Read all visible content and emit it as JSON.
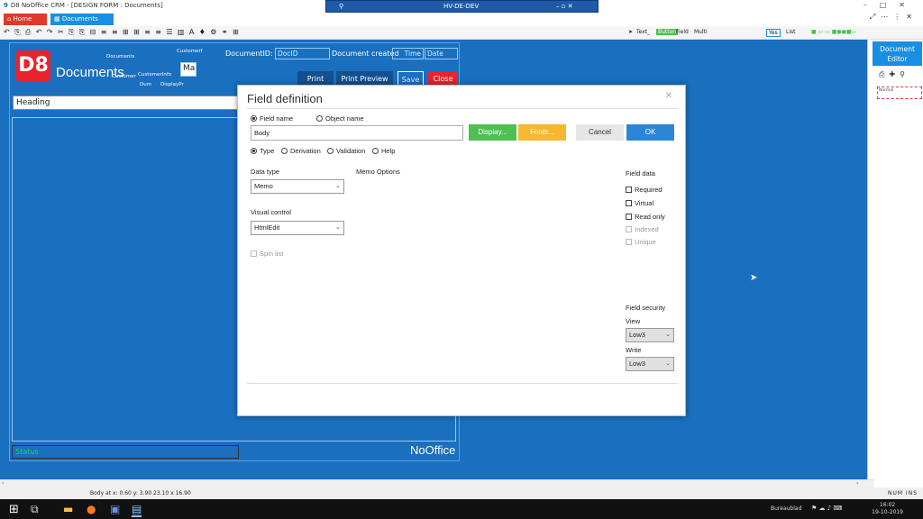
{
  "window": {
    "title": "D8 NoOffice CRM - [DESIGN FORM : Documents]",
    "rdp_host": "HV-DE-DEV"
  },
  "tabs": [
    {
      "label": "Home"
    },
    {
      "label": "Documents"
    }
  ],
  "toolbar_right": {
    "text_label": "Text_",
    "button_badge": "Button",
    "field_label": "Field",
    "multi_label": "Multi",
    "yes_label": "Yes",
    "list_label": "List"
  },
  "form": {
    "logo_text": "D8",
    "title": "Documents",
    "small_labels": [
      "Documents",
      "Customer",
      "CustomerInfo",
      "Customerf",
      "Dum",
      "DisplayPr"
    ],
    "ma_box": "Ma",
    "document_id_label": "DocumentID:",
    "document_id_value": "DocID",
    "document_created_label": "Document created",
    "time_value": "Time",
    "date_value": "Date",
    "buttons": {
      "print": "Print",
      "print_preview": "Print Preview",
      "save": "Save",
      "close": "Close"
    },
    "heading_field": "Heading",
    "status_field": "Status",
    "brand": "NoOffice"
  },
  "right_panel": {
    "title": "Document Editor",
    "sample_text": "Normal"
  },
  "statusbar": {
    "coords": "Body   at  x: 0.60  y: 3.90      23.10 x 16.90",
    "num": "NUM   INS"
  },
  "taskbar": {
    "desktop_label": "Bureaublad",
    "time": "16:02",
    "date": "19-10-2019"
  },
  "dialog": {
    "title": "Field definition",
    "radio_fieldname": "Field name",
    "radio_objectname": "Object name",
    "name_value": "Body",
    "btn_display": "Display...",
    "btn_fonts": "Fonts...",
    "btn_cancel": "Cancel",
    "btn_ok": "OK",
    "tab_type": "Type",
    "tab_derivation": "Derivation",
    "tab_validation": "Validation",
    "tab_help": "Help",
    "data_type_label": "Data type",
    "data_type_value": "Memo",
    "memo_options_label": "Memo Options",
    "visual_control_label": "Visual control",
    "visual_control_value": "HtmlEdit",
    "spin_list_label": "Spin list",
    "field_data_label": "Field data",
    "required_label": "Required",
    "virtual_label": "Virtual",
    "readonly_label": "Read only",
    "indexed_label": "Indexed",
    "unique_label": "Unique",
    "field_security_label": "Field security",
    "view_label": "View",
    "view_value": "Low3",
    "write_label": "Write",
    "write_value": "Low3"
  },
  "colors": {
    "canvas": "#1a6fbf",
    "home_tab": "#e03a2a",
    "documents_tab": "#1a8ee0",
    "display_btn": "#4cc050",
    "fonts_btn": "#f5b82e",
    "ok_btn": "#2c86d8",
    "close_btn": "#e8232d"
  }
}
